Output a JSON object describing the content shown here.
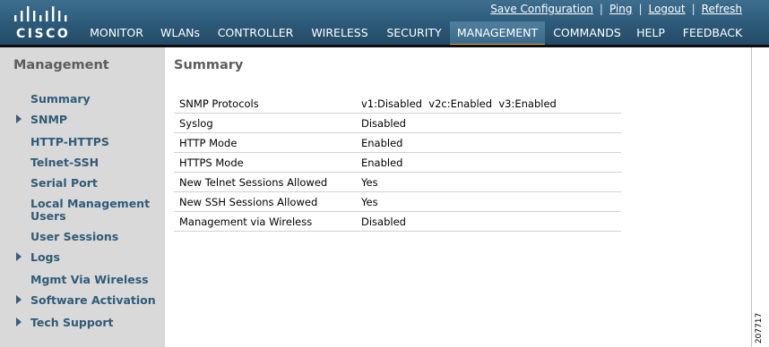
{
  "header": {
    "logo_text": "CISCO",
    "utility_links": [
      "Save Configuration",
      "Ping",
      "Logout",
      "Refresh"
    ],
    "nav": [
      {
        "label": "MONITOR",
        "accel": "M"
      },
      {
        "label": "WLANs",
        "accel": "W"
      },
      {
        "label": "CONTROLLER",
        "accel": "C"
      },
      {
        "label": "WIRELESS",
        "accel": "I"
      },
      {
        "label": "SECURITY",
        "accel": "S"
      },
      {
        "label": "MANAGEMENT",
        "accel": "A"
      },
      {
        "label": "COMMANDS",
        "accel": "O"
      },
      {
        "label": "HELP",
        "accel": ""
      },
      {
        "label": "FEEDBACK",
        "accel": "F"
      }
    ],
    "active_nav": "MANAGEMENT"
  },
  "sidebar": {
    "title": "Management",
    "items": [
      {
        "label": "Summary",
        "expandable": false
      },
      {
        "label": "SNMP",
        "expandable": true
      },
      {
        "label": "HTTP-HTTPS",
        "expandable": false
      },
      {
        "label": "Telnet-SSH",
        "expandable": false
      },
      {
        "label": "Serial Port",
        "expandable": false
      },
      {
        "label": "Local Management Users",
        "expandable": false
      },
      {
        "label": "User Sessions",
        "expandable": false
      },
      {
        "label": "Logs",
        "expandable": true
      },
      {
        "label": "Mgmt Via Wireless",
        "expandable": false
      },
      {
        "label": "Software Activation",
        "expandable": true
      },
      {
        "label": "Tech Support",
        "expandable": true
      }
    ]
  },
  "main": {
    "title": "Summary",
    "rows": [
      {
        "label": "SNMP Protocols",
        "value": "v1:Disabled  v2c:Enabled  v3:Enabled"
      },
      {
        "label": "Syslog",
        "value": "Disabled"
      },
      {
        "label": "HTTP Mode",
        "value": "Enabled"
      },
      {
        "label": "HTTPS Mode",
        "value": "Enabled"
      },
      {
        "label": "New Telnet Sessions Allowed",
        "value": "Yes"
      },
      {
        "label": "New SSH Sessions Allowed",
        "value": "Yes"
      },
      {
        "label": "Management via Wireless",
        "value": "Disabled"
      }
    ]
  },
  "figure_id": "207717",
  "colors": {
    "header": "#2c5978",
    "active_tab_underline": "#e8a223",
    "sidebar_bg": "#d9d9d9",
    "sidebar_link": "#2f5b78"
  }
}
